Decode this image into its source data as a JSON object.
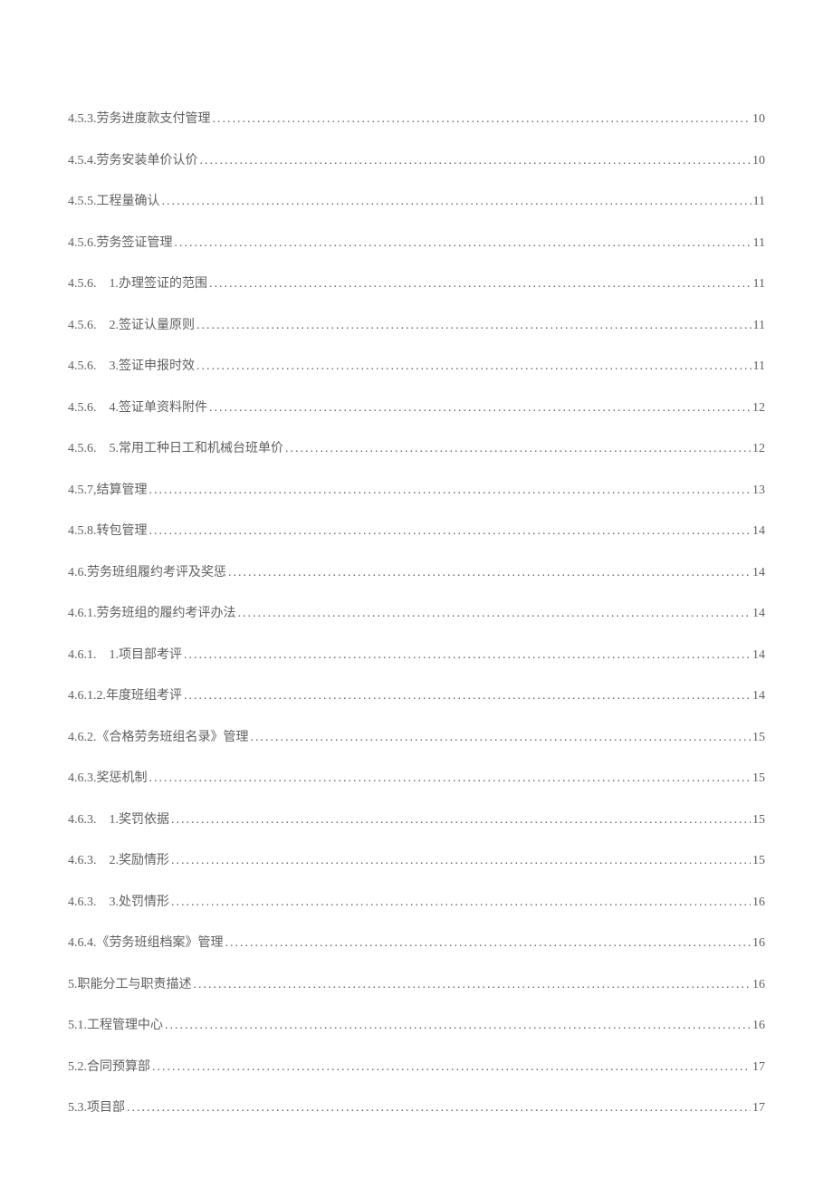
{
  "toc": [
    {
      "num": "4.5.3.",
      "label": "劳务进度款支付管理",
      "page": "10"
    },
    {
      "num": "4.5.4.",
      "label": "劳务安装单价认价",
      "page": "10"
    },
    {
      "num": "4.5.5.",
      "label": "工程量确认",
      "page": "11"
    },
    {
      "num": "4.5.6.",
      "label": "劳务签证管理",
      "page": "11"
    },
    {
      "num": "4.5.6.　1.",
      "label": "办理签证的范围",
      "page": "11"
    },
    {
      "num": "4.5.6.　2.",
      "label": "签证认量原则",
      "page": "11"
    },
    {
      "num": "4.5.6.　3.",
      "label": "签证申报时效",
      "page": "11"
    },
    {
      "num": "4.5.6.　4.",
      "label": "签证单资料附件",
      "page": "12"
    },
    {
      "num": "4.5.6.　5.",
      "label": "常用工种日工和机械台班单价",
      "page": "12"
    },
    {
      "num": "4.5.7,",
      "label": "结算管理",
      "page": "13"
    },
    {
      "num": "4.5.8.",
      "label": "转包管理",
      "page": "14"
    },
    {
      "num": "4.6.",
      "label": "劳务班组履约考评及奖惩",
      "page": "14"
    },
    {
      "num": "4.6.1.",
      "label": "劳务班组的履约考评办法",
      "page": "14"
    },
    {
      "num": "4.6.1.　1.",
      "label": "项目部考评",
      "page": "14"
    },
    {
      "num": "4.6.1.2.",
      "label": "年度班组考评",
      "page": "14"
    },
    {
      "num": "4.6.2.",
      "label": "《合格劳务班组名录》管理",
      "page": "15"
    },
    {
      "num": "4.6.3.",
      "label": "奖惩机制",
      "page": "15"
    },
    {
      "num": "4.6.3.　1.",
      "label": "奖罚依据",
      "page": "15"
    },
    {
      "num": "4.6.3.　2.",
      "label": "奖励情形",
      "page": "15"
    },
    {
      "num": "4.6.3.　3.",
      "label": "处罚情形",
      "page": "16"
    },
    {
      "num": "4.6.4.",
      "label": "《劳务班组档案》管理",
      "page": "16"
    },
    {
      "num": "5.",
      "label": "职能分工与职责描述",
      "page": "16"
    },
    {
      "num": "5.1.",
      "label": "工程管理中心",
      "page": "16"
    },
    {
      "num": "5.2.",
      "label": "合同预算部",
      "page": "17"
    },
    {
      "num": "5.3.",
      "label": "项目部",
      "page": "17"
    }
  ]
}
